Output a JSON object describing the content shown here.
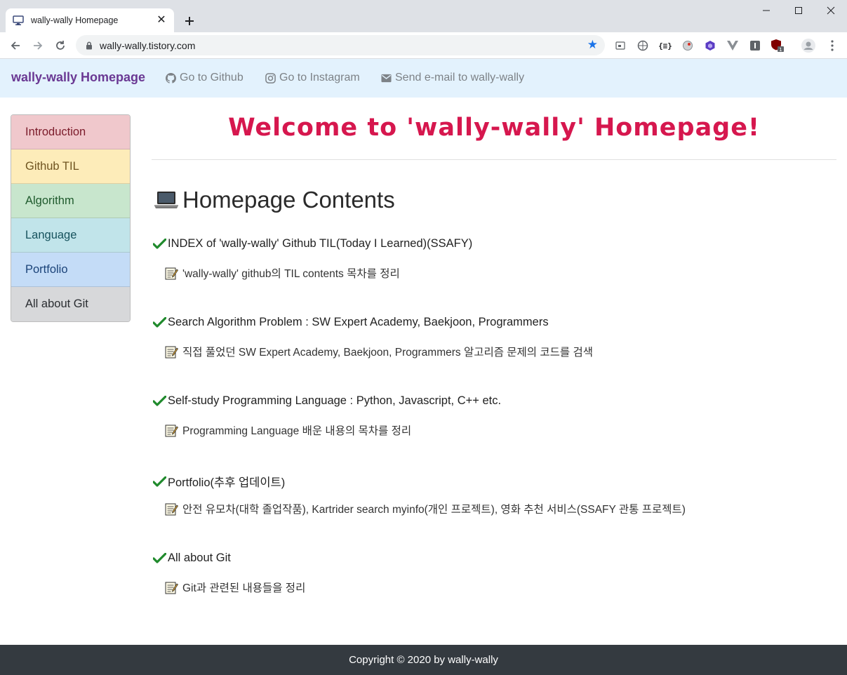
{
  "browser": {
    "tab_title": "wally-wally Homepage",
    "url": "wally-wally.tistory.com"
  },
  "site": {
    "brand": "wally-wally Homepage",
    "nav": [
      {
        "label": "Go to Github",
        "icon": "github-icon"
      },
      {
        "label": "Go to Instagram",
        "icon": "instagram-icon"
      },
      {
        "label": "Send e-mail to wally-wally",
        "icon": "envelope-icon"
      }
    ]
  },
  "sidebar": {
    "items": [
      {
        "label": "Introduction",
        "bg": "#f0c8cc",
        "color": "#7b1b2a"
      },
      {
        "label": "Github TIL",
        "bg": "#fdecb9",
        "color": "#6f5420"
      },
      {
        "label": "Algorithm",
        "bg": "#c8e6cd",
        "color": "#1f5a2d"
      },
      {
        "label": "Language",
        "bg": "#c1e4ea",
        "color": "#17535e"
      },
      {
        "label": "Portfolio",
        "bg": "#c4dcf7",
        "color": "#1b4379"
      },
      {
        "label": "All about Git",
        "bg": "#d7d8da",
        "color": "#2a2d31"
      }
    ]
  },
  "main": {
    "welcome": "Welcome to 'wally-wally' Homepage!",
    "heading": "Homepage Contents",
    "items": [
      {
        "title": "INDEX of 'wally-wally' Github TIL(Today I Learned)(SSAFY)",
        "desc": "'wally-wally' github의 TIL contents 목차를 정리"
      },
      {
        "title": "Search Algorithm Problem : SW Expert Academy, Baekjoon, Programmers",
        "desc": "직접 풀었던 SW Expert Academy, Baekjoon, Programmers 알고리즘 문제의 코드를 검색"
      },
      {
        "title": "Self-study Programming Language : Python, Javascript, C++ etc.",
        "desc": "Programming Language 배운 내용의 목차를 정리"
      },
      {
        "title": "Portfolio(추후 업데이트)",
        "desc": "안전 유모차(대학 졸업작품), Kartrider search myinfo(개인 프로젝트), 영화 추천 서비스(SSAFY 관통 프로젝트)"
      },
      {
        "title": "All about Git",
        "desc": "Git과 관련된 내용들을 정리"
      }
    ]
  },
  "footer": {
    "text": "Copyright © 2020 by  wally-wally"
  },
  "colors": {
    "brand": "#6a3893",
    "welcome": "#d6174e",
    "navbar_bg": "#e3f2fd",
    "footer_bg": "#343a40"
  }
}
